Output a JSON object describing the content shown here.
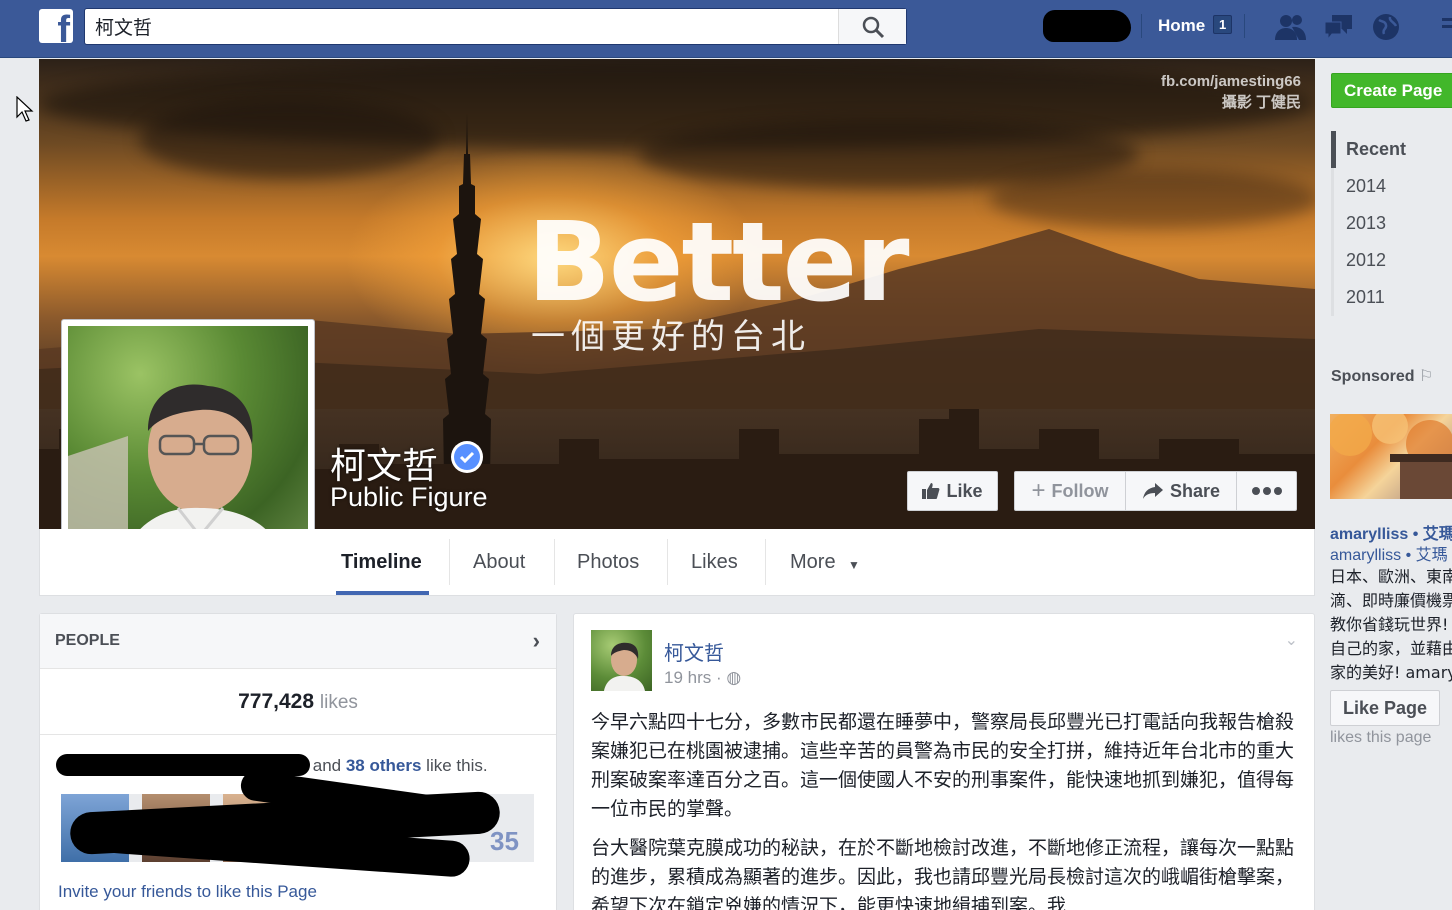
{
  "topbar": {
    "search_value": "柯文哲",
    "home_label": "Home",
    "home_count": "1"
  },
  "cover": {
    "watermark_line1": "fb.com/jamesting66",
    "watermark_line2": "攝影 丁健民",
    "headline": "Better",
    "subheadline": "一個更好的台北"
  },
  "page": {
    "name": "柯文哲",
    "category": "Public Figure"
  },
  "actions": {
    "like": "Like",
    "follow": "Follow",
    "share": "Share"
  },
  "tabs": {
    "timeline": "Timeline",
    "about": "About",
    "photos": "Photos",
    "likes": "Likes",
    "more": "More"
  },
  "sidebar": {
    "create_page": "Create Page",
    "years": [
      "Recent",
      "2014",
      "2013",
      "2012",
      "2011"
    ],
    "sponsored": "Sponsored",
    "ad_name": "amarylliss • 艾瑪",
    "ad_sub": "amarylliss • 艾瑪",
    "ad_lines": [
      "日本、歐洲、東南",
      "滴、即時廉價機票",
      "教你省錢玩世界!",
      "自己的家，並藉由",
      "家的美好! amary"
    ],
    "like_page": "Like Page",
    "likes_this": "likes this page"
  },
  "people": {
    "heading": "PEOPLE",
    "likes_number": "777,428",
    "likes_label": "likes",
    "and_text": "and",
    "others_link": "38 others",
    "like_this_text": "like this.",
    "thumb_count": "35",
    "invite": "Invite your friends to like this Page"
  },
  "post": {
    "author": "柯文哲",
    "time": "19 hrs",
    "para1": "今早六點四十七分，多數市民都還在睡夢中，警察局長邱豐光已打電話向我報告槍殺案嫌犯已在桃園被逮捕。這些辛苦的員警為市民的安全打拼，維持近年台北市的重大刑案破案率達百分之百。這一個使國人不安的刑事案件，能快速地抓到嫌犯，值得每一位市民的掌聲。",
    "para2": "台大醫院葉克膜成功的秘訣，在於不斷地檢討改進，不斷地修正流程，讓每次一點點的進步，累積成為顯著的進步。因此，我也請邱豐光局長檢討這次的峨嵋街槍擊案，希望下次在鎖定兇嫌的情況下，能更快速地緝捕到案。我"
  },
  "colors": {
    "brand": "#3b5998",
    "link": "#365899",
    "green": "#42b72a"
  }
}
